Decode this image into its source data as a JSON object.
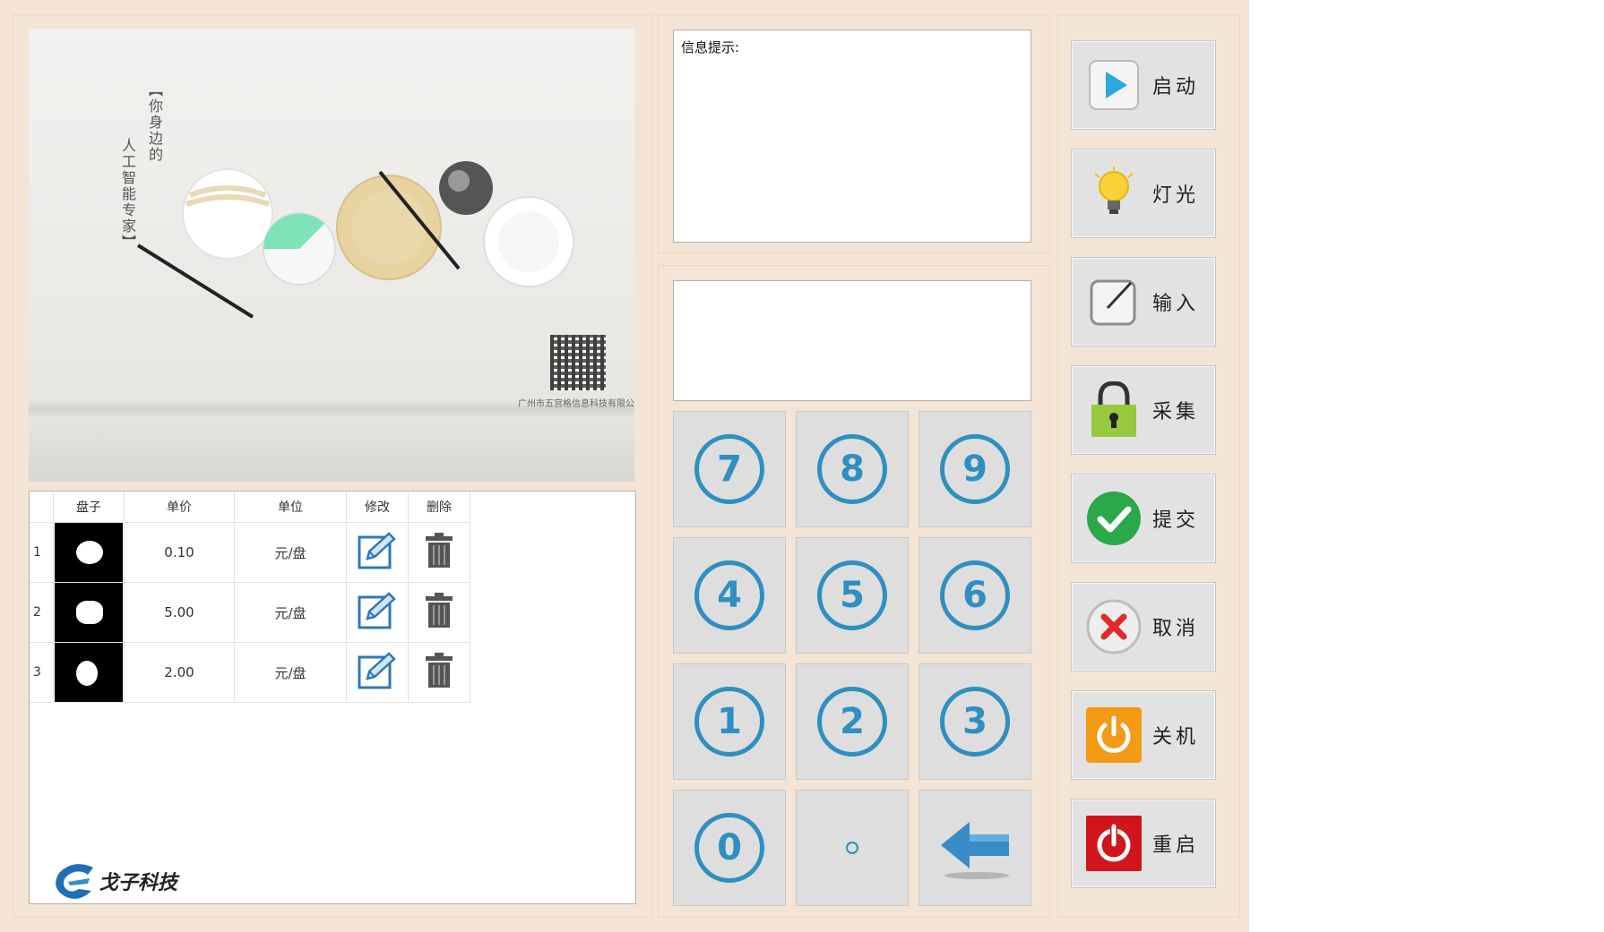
{
  "left": {
    "ad": {
      "line1": "【你身边的",
      "line2": "人工智能专家】",
      "company": "广州市五宫格信息科技有限公"
    },
    "table": {
      "headers": [
        "盘子",
        "单价",
        "单位",
        "修改",
        "删除"
      ],
      "rows": [
        {
          "index": "1",
          "price": "0.10",
          "unit": "元/盘"
        },
        {
          "index": "2",
          "price": "5.00",
          "unit": "元/盘"
        },
        {
          "index": "3",
          "price": "2.00",
          "unit": "元/盘"
        }
      ]
    },
    "brand": "戈子科技"
  },
  "info": {
    "label": "信息提示:",
    "message": ""
  },
  "input": {
    "value": ""
  },
  "keypad": {
    "keys": [
      "7",
      "8",
      "9",
      "4",
      "5",
      "6",
      "1",
      "2",
      "3",
      "0",
      ".",
      "back"
    ]
  },
  "actions": {
    "start": "启动",
    "light": "灯光",
    "input": "输入",
    "collect": "采集",
    "submit": "提交",
    "cancel": "取消",
    "shutdown": "关机",
    "restart": "重启"
  },
  "colors": {
    "background": "#f5e3d3",
    "key_accent": "#2f8fc0",
    "submit_green": "#2aa84a",
    "cancel_red": "#e02a2a",
    "power_orange": "#f49a16",
    "restart_red": "#d0161c"
  },
  "icons": {
    "start": "play-icon",
    "light": "bulb-icon",
    "input": "pencil-box-icon",
    "collect": "padlock-icon",
    "submit": "check-icon",
    "cancel": "x-icon",
    "shutdown": "power-icon",
    "restart": "power-icon",
    "edit": "pencil-icon",
    "delete": "trash-icon",
    "back": "left-arrow-icon"
  }
}
